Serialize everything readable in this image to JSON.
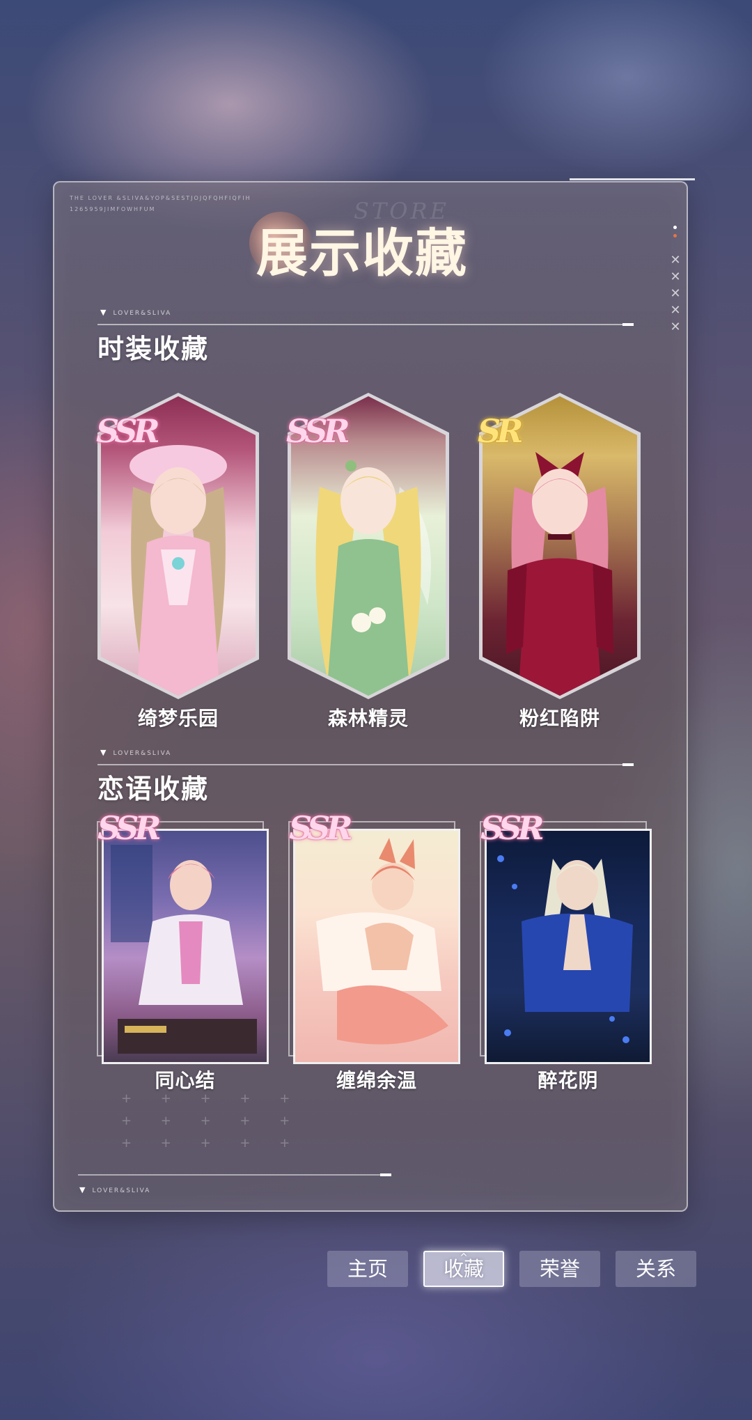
{
  "panel": {
    "title": "展示收藏",
    "ghost_title": "STORE",
    "micro_line1": "THE LOVER &SLIVA&YOP&SESTJOJQFQHFIQFIH",
    "micro_line2": "1265959JIMFOWHFUM",
    "bottom_tag": "LOVER&SLIVA"
  },
  "sections": [
    {
      "tag": "LOVER&SLIVA",
      "title": "时装收藏",
      "cards": [
        {
          "rarity": "SSR",
          "name": "绮梦乐园"
        },
        {
          "rarity": "SSR",
          "name": "森林精灵"
        },
        {
          "rarity": "SR",
          "name": "粉红陷阱"
        }
      ]
    },
    {
      "tag": "LOVER&SLIVA",
      "title": "恋语收藏",
      "cards": [
        {
          "rarity": "SSR",
          "name": "同心结"
        },
        {
          "rarity": "SSR",
          "name": "缠绵余温"
        },
        {
          "rarity": "SSR",
          "name": "醉花阴"
        }
      ]
    }
  ],
  "tabs": [
    {
      "label": "主页",
      "active": false
    },
    {
      "label": "收藏",
      "active": true
    },
    {
      "label": "荣誉",
      "active": false
    },
    {
      "label": "关系",
      "active": false
    }
  ],
  "colors": {
    "ssr": "#ff7fb6",
    "sr": "#ffd24a",
    "accent_dot": "#e67448"
  }
}
